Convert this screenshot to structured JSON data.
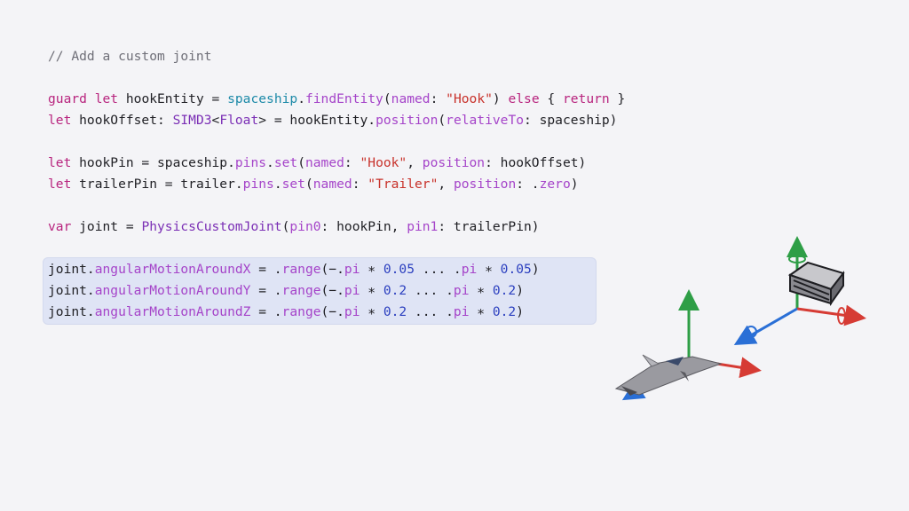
{
  "code": {
    "lines": [
      [
        {
          "t": "// Add a custom joint",
          "c": "comment"
        }
      ],
      [],
      [
        {
          "t": "guard",
          "c": "kw"
        },
        {
          "t": " "
        },
        {
          "t": "let",
          "c": "kw"
        },
        {
          "t": " hookEntity = "
        },
        {
          "t": "spaceship",
          "c": "fn"
        },
        {
          "t": "."
        },
        {
          "t": "findEntity",
          "c": "mem"
        },
        {
          "t": "("
        },
        {
          "t": "named",
          "c": "mem"
        },
        {
          "t": ": "
        },
        {
          "t": "\"Hook\"",
          "c": "str"
        },
        {
          "t": ") "
        },
        {
          "t": "else",
          "c": "kw"
        },
        {
          "t": " { "
        },
        {
          "t": "return",
          "c": "kw"
        },
        {
          "t": " }"
        }
      ],
      [
        {
          "t": "let",
          "c": "kw"
        },
        {
          "t": " hookOffset: "
        },
        {
          "t": "SIMD3",
          "c": "ty"
        },
        {
          "t": "<"
        },
        {
          "t": "Float",
          "c": "ty"
        },
        {
          "t": "> = hookEntity."
        },
        {
          "t": "position",
          "c": "mem"
        },
        {
          "t": "("
        },
        {
          "t": "relativeTo",
          "c": "mem"
        },
        {
          "t": ": spaceship)"
        }
      ],
      [],
      [
        {
          "t": "let",
          "c": "kw"
        },
        {
          "t": " hookPin = spaceship."
        },
        {
          "t": "pins",
          "c": "mem"
        },
        {
          "t": "."
        },
        {
          "t": "set",
          "c": "mem"
        },
        {
          "t": "("
        },
        {
          "t": "named",
          "c": "mem"
        },
        {
          "t": ": "
        },
        {
          "t": "\"Hook\"",
          "c": "str"
        },
        {
          "t": ", "
        },
        {
          "t": "position",
          "c": "mem"
        },
        {
          "t": ": hookOffset)"
        }
      ],
      [
        {
          "t": "let",
          "c": "kw"
        },
        {
          "t": " trailerPin = trailer."
        },
        {
          "t": "pins",
          "c": "mem"
        },
        {
          "t": "."
        },
        {
          "t": "set",
          "c": "mem"
        },
        {
          "t": "("
        },
        {
          "t": "named",
          "c": "mem"
        },
        {
          "t": ": "
        },
        {
          "t": "\"Trailer\"",
          "c": "str"
        },
        {
          "t": ", "
        },
        {
          "t": "position",
          "c": "mem"
        },
        {
          "t": ": ."
        },
        {
          "t": "zero",
          "c": "mem"
        },
        {
          "t": ")"
        }
      ],
      [],
      [
        {
          "t": "var",
          "c": "kw"
        },
        {
          "t": " joint = "
        },
        {
          "t": "PhysicsCustomJoint",
          "c": "ty"
        },
        {
          "t": "("
        },
        {
          "t": "pin0",
          "c": "mem"
        },
        {
          "t": ": hookPin, "
        },
        {
          "t": "pin1",
          "c": "mem"
        },
        {
          "t": ": trailerPin)"
        }
      ],
      [],
      [
        {
          "t": "joint."
        },
        {
          "t": "angularMotionAroundX",
          "c": "mem"
        },
        {
          "t": " = ."
        },
        {
          "t": "range",
          "c": "mem"
        },
        {
          "t": "(−."
        },
        {
          "t": "pi",
          "c": "mem"
        },
        {
          "t": " ∗ "
        },
        {
          "t": "0.05",
          "c": "num"
        },
        {
          "t": " ... ."
        },
        {
          "t": "pi",
          "c": "mem"
        },
        {
          "t": " ∗ "
        },
        {
          "t": "0.05",
          "c": "num"
        },
        {
          "t": ")"
        }
      ],
      [
        {
          "t": "joint."
        },
        {
          "t": "angularMotionAroundY",
          "c": "mem"
        },
        {
          "t": " = ."
        },
        {
          "t": "range",
          "c": "mem"
        },
        {
          "t": "(−."
        },
        {
          "t": "pi",
          "c": "mem"
        },
        {
          "t": " ∗ "
        },
        {
          "t": "0.2",
          "c": "num"
        },
        {
          "t": " ... ."
        },
        {
          "t": "pi",
          "c": "mem"
        },
        {
          "t": " ∗ "
        },
        {
          "t": "0.2",
          "c": "num"
        },
        {
          "t": ")"
        }
      ],
      [
        {
          "t": "joint."
        },
        {
          "t": "angularMotionAroundZ",
          "c": "mem"
        },
        {
          "t": " = ."
        },
        {
          "t": "range",
          "c": "mem"
        },
        {
          "t": "(−."
        },
        {
          "t": "pi",
          "c": "mem"
        },
        {
          "t": " ∗ "
        },
        {
          "t": "0.2",
          "c": "num"
        },
        {
          "t": " ... ."
        },
        {
          "t": "pi",
          "c": "mem"
        },
        {
          "t": " ∗ "
        },
        {
          "t": "0.2",
          "c": "num"
        },
        {
          "t": ")"
        }
      ]
    ]
  },
  "colors": {
    "background": "#f4f4f7",
    "highlight": "#dfe4f5",
    "axis_x": "#d63b34",
    "axis_y": "#2e9e46",
    "axis_z": "#2a6fd6"
  },
  "illustration": {
    "objects": [
      "spaceship",
      "trailer"
    ],
    "icons": [
      "spaceship-icon",
      "trailer-icon",
      "axis-gizmo-icon",
      "rotation-arrow-icon"
    ]
  }
}
